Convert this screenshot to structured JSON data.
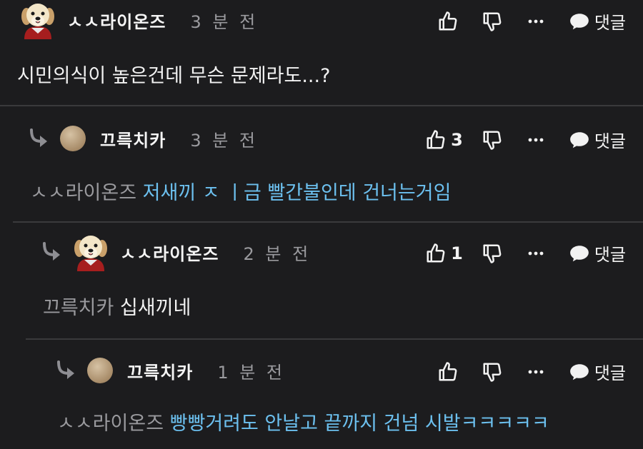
{
  "comments": [
    {
      "username": "ㅅㅅ라이온즈",
      "time": "3 분 전",
      "text": "시민의식이 높은건데 무슨 문제라도...?",
      "like_count": "",
      "reply_label": "댓글",
      "avatar": "puppy-avatar"
    },
    {
      "username": "끄륵치카",
      "time": "3 분 전",
      "mention": "ㅅㅅ라이온즈",
      "text": "저새끼 ㅈ ㅣ금 빨간불인데 건너는거임",
      "like_count": "3",
      "reply_label": "댓글",
      "avatar": "beige-dot-avatar"
    },
    {
      "username": "ㅅㅅ라이온즈",
      "time": "2 분 전",
      "mention": "끄륵치카",
      "text": "십새끼네",
      "like_count": "1",
      "reply_label": "댓글",
      "avatar": "puppy-avatar"
    },
    {
      "username": "끄륵치카",
      "time": "1 분 전",
      "mention": "ㅅㅅ라이온즈",
      "text": "빵빵거려도 안날고 끝까지 건넘 시발ㅋㅋㅋㅋㅋ",
      "like_count": "",
      "reply_label": "댓글",
      "avatar": "beige-dot-avatar"
    }
  ],
  "colors": {
    "background": "#1c1c1e",
    "mention": "#9a9a9e",
    "link_blue": "#6cc0ef",
    "divider": "#3a3a3c"
  }
}
